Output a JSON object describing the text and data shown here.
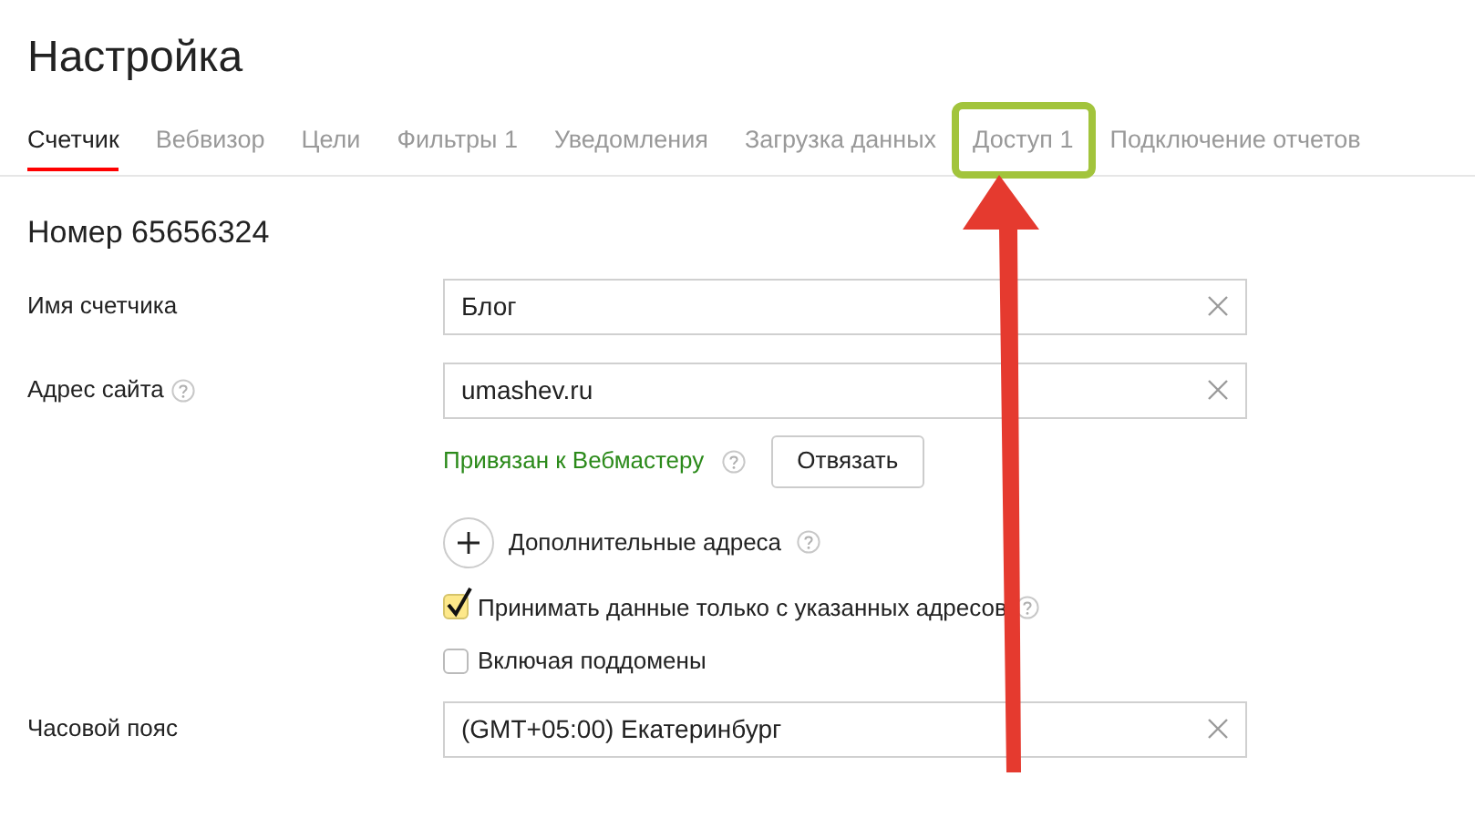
{
  "page": {
    "title": "Настройка"
  },
  "tabs": [
    {
      "label": "Счетчик",
      "selected": true,
      "highlighted": false
    },
    {
      "label": "Вебвизор",
      "selected": false,
      "highlighted": false
    },
    {
      "label": "Цели",
      "selected": false,
      "highlighted": false
    },
    {
      "label": "Фильтры 1",
      "selected": false,
      "highlighted": false
    },
    {
      "label": "Уведомления",
      "selected": false,
      "highlighted": false
    },
    {
      "label": "Загрузка данных",
      "selected": false,
      "highlighted": false
    },
    {
      "label": "Доступ 1",
      "selected": false,
      "highlighted": true
    },
    {
      "label": "Подключение отчетов",
      "selected": false,
      "highlighted": false
    }
  ],
  "section": {
    "title": "Номер 65656324"
  },
  "counter_name": {
    "label": "Имя счетчика",
    "value": "Блог"
  },
  "site_address": {
    "label": "Адрес сайта",
    "value": "umashev.ru",
    "webmaster_status": "Привязан к Вебмастеру",
    "unlink_button": "Отвязать"
  },
  "additional_addresses": {
    "label": "Дополнительные адреса"
  },
  "checkboxes": [
    {
      "label": "Принимать данные только с указанных адресов",
      "checked": true,
      "help": true
    },
    {
      "label": "Включая поддомены",
      "checked": false,
      "help": false
    }
  ],
  "timezone": {
    "label": "Часовой пояс",
    "value": "(GMT+05:00) Екатеринбург"
  }
}
